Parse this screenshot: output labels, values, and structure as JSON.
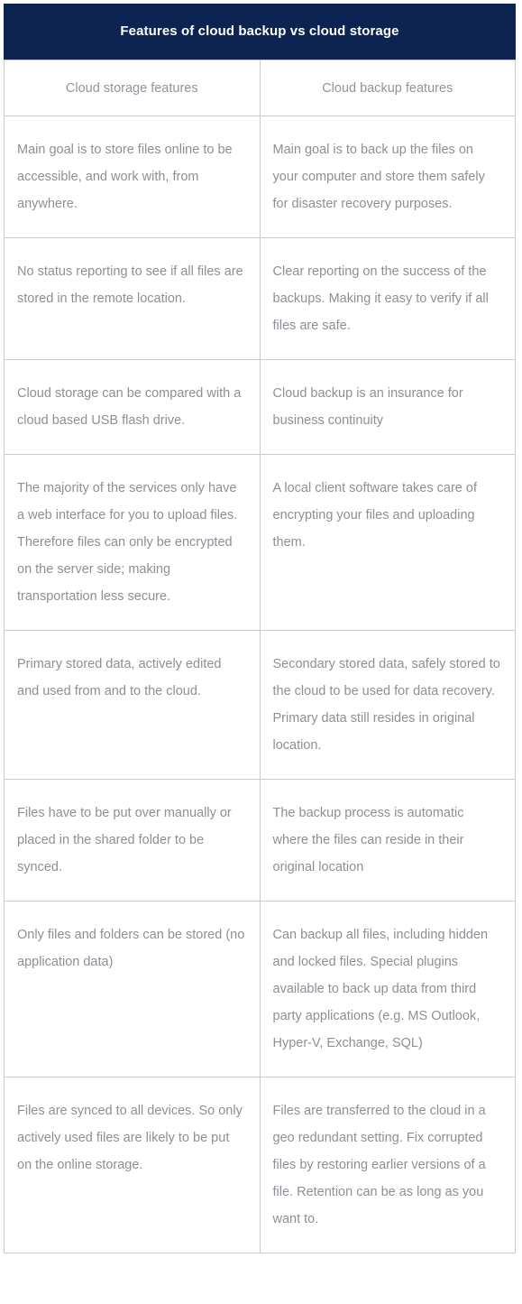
{
  "header": {
    "title": "Features of cloud backup vs cloud storage",
    "background_color": "#0d2352",
    "text_color": "#ffffff"
  },
  "table": {
    "border_color": "#c9cbcf",
    "header_text_color": "#8f949c",
    "body_text_color": "#8c9096",
    "columns": [
      {
        "key": "storage",
        "label": "Cloud storage features"
      },
      {
        "key": "backup",
        "label": "Cloud backup features"
      }
    ],
    "rows": [
      {
        "storage": "Main goal is to store files online to be accessible, and work with, from anywhere.",
        "backup": "Main goal is to back up the files on your computer and store them safely for disaster recovery purposes."
      },
      {
        "storage": "No status reporting to see if all files are stored in the remote location.",
        "backup": "Clear reporting on the success of the backups. Making it easy to verify if all files are safe."
      },
      {
        "storage": "Cloud storage can be compared with a cloud based USB flash drive.",
        "backup": "Cloud backup is an insurance for business continuity"
      },
      {
        "storage": "The majority of the services only have a web interface for you to upload files. Therefore files can only be encrypted on the server side; making transportation less secure.",
        "backup": "A local client software takes care of encrypting your files and uploading them."
      },
      {
        "storage": "Primary stored data, actively edited and used from and to the cloud.",
        "backup": "Secondary stored data, safely stored to the cloud to be used for data recovery. Primary data still resides in original location."
      },
      {
        "storage": "Files have to be put over manually or placed in the shared folder to be synced.",
        "backup": "The backup process is automatic where the files can reside in their original location"
      },
      {
        "storage": "Only files and folders can be stored (no application data)",
        "backup": "Can backup all files, including hidden and locked files. Special plugins available to back up data from third party applications (e.g. MS Outlook, Hyper-V, Exchange, SQL)"
      },
      {
        "storage": "Files are synced to all devices. So only actively used files are likely to be put on the online storage.",
        "backup": "Files are transferred to the cloud in a geo redundant setting. Fix corrupted files by restoring earlier versions of a file. Retention can be as long as you want to."
      }
    ]
  }
}
